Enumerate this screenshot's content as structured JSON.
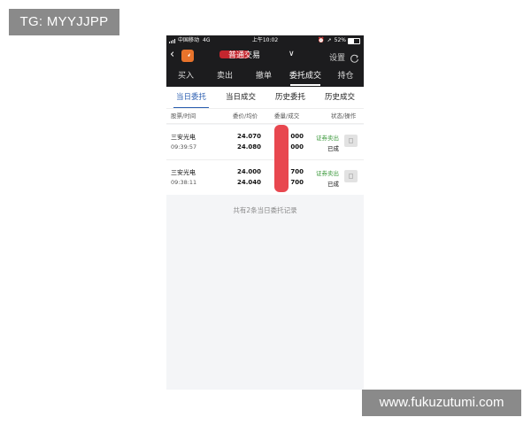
{
  "watermarks": {
    "top": "TG: MYYJJPP",
    "bottom": "www.fukuzutumi.com"
  },
  "status_bar": {
    "carrier": "中国移动",
    "network": "4G",
    "time": "上午10:02",
    "battery": "52%"
  },
  "nav": {
    "title": "普通交易",
    "settings_label": "设置"
  },
  "tabs": [
    {
      "label": "买入"
    },
    {
      "label": "卖出"
    },
    {
      "label": "撤单"
    },
    {
      "label": "委托成交"
    },
    {
      "label": "持仓"
    }
  ],
  "active_tab": 3,
  "subtabs": [
    {
      "label": "当日委托"
    },
    {
      "label": "当日成交"
    },
    {
      "label": "历史委托"
    },
    {
      "label": "历史成交"
    }
  ],
  "active_subtab": 0,
  "columns": [
    "股票/时间",
    "委价/均价",
    "委量/成交",
    "状态/操作"
  ],
  "rows": [
    {
      "name": "三安光电",
      "time": "09:39:57",
      "price": "24.070",
      "avg_price": "24.080",
      "qty": "000",
      "filled": "000",
      "action": "证券卖出",
      "status": "已成"
    },
    {
      "name": "三安光电",
      "time": "09:38:11",
      "price": "24.000",
      "avg_price": "24.040",
      "qty": "700",
      "filled": "700",
      "action": "证券卖出",
      "status": "已成"
    }
  ],
  "footer": "共有2条当日委托记录",
  "colors": {
    "dark_bar": "#1c1c1e",
    "accent_blue": "#2a5db0",
    "sell_green": "#3d9a3d",
    "logo_orange": "#e8732b",
    "redaction_red": "#e8474f"
  }
}
